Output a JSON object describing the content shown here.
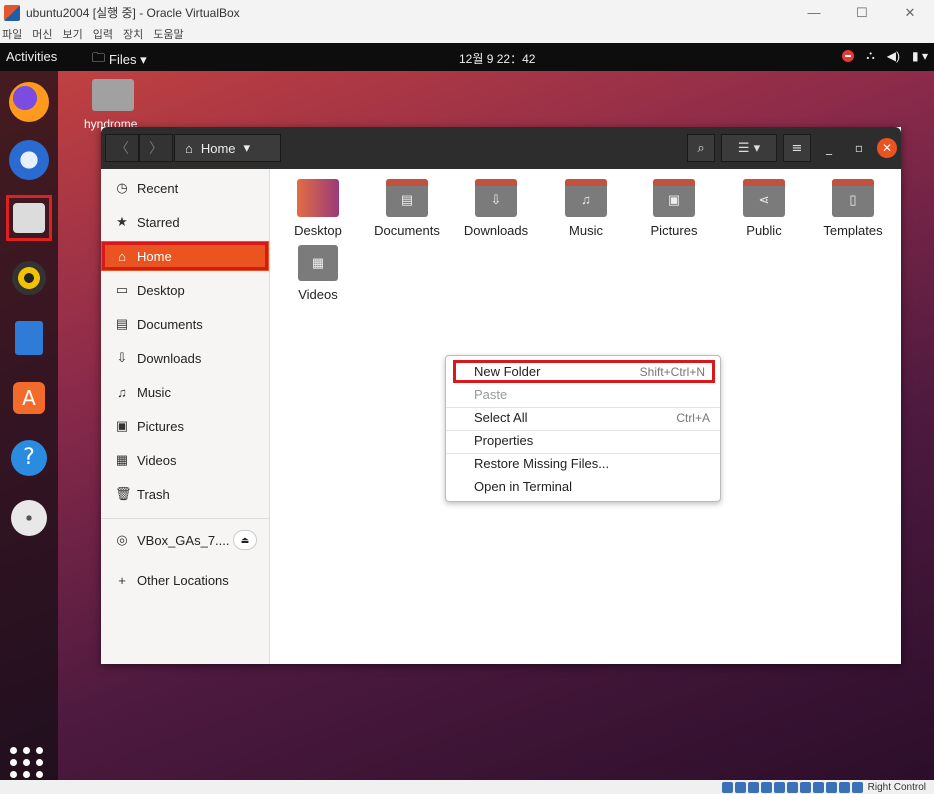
{
  "host": {
    "title": "ubuntu2004 [실행 중] - Oracle VirtualBox",
    "menu": [
      "파일",
      "머신",
      "보기",
      "입력",
      "장치",
      "도움말"
    ],
    "controls": {
      "minimize": "—",
      "maximize": "☐",
      "close": "✕"
    },
    "status_text": "Right Control"
  },
  "topbar": {
    "activities": "Activities",
    "app_menu": "Files ▾",
    "clock": "12월 9 22：42"
  },
  "desktop": {
    "home_label": "hyndrome"
  },
  "window": {
    "path_label": "Home",
    "sidebar": {
      "recent": "Recent",
      "starred": "Starred",
      "home": "Home",
      "desktop": "Desktop",
      "documents": "Documents",
      "downloads": "Downloads",
      "music": "Music",
      "pictures": "Pictures",
      "videos": "Videos",
      "trash": "Trash",
      "drive": "VBox_GAs_7....",
      "other": "Other Locations"
    },
    "folders": {
      "desktop": "Desktop",
      "documents": "Documents",
      "downloads": "Downloads",
      "music": "Music",
      "pictures": "Pictures",
      "public": "Public",
      "templates": "Templates",
      "videos": "Videos"
    }
  },
  "context_menu": {
    "new_folder": "New Folder",
    "new_folder_accel": "Shift+Ctrl+N",
    "paste": "Paste",
    "select_all": "Select All",
    "select_all_accel": "Ctrl+A",
    "properties": "Properties",
    "restore": "Restore Missing Files...",
    "terminal": "Open in Terminal"
  }
}
